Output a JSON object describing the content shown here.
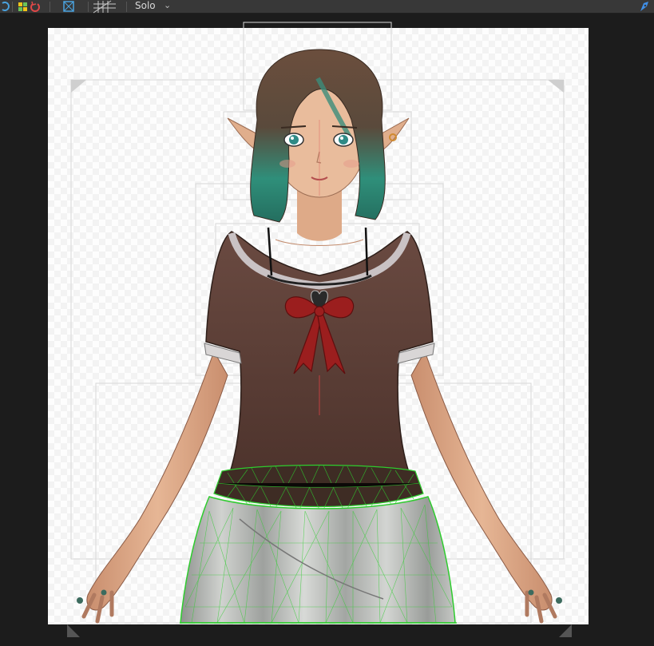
{
  "toolbar": {
    "solo_label": "Solo",
    "solo_dropdown_icon": "chevron-down-icon",
    "icons": [
      "refresh-icon",
      "color-palette-icon",
      "reset-icon",
      "mesh-frame-icon",
      "grid-icon",
      "pen-tool-icon"
    ]
  },
  "colors": {
    "toolbar_bg": "#383838",
    "viewport_bg": "#1c1c1c",
    "canvas_bg": "#fdfdfd",
    "mesh_green": "#2ecc2e",
    "accent_blue": "#4a90e2",
    "shirt": "#5a3b33",
    "skirt": "#b8bab8",
    "hair": "#6b4e3d",
    "hair_tips": "#2f8f7a",
    "ribbon": "#9b1e1e"
  }
}
